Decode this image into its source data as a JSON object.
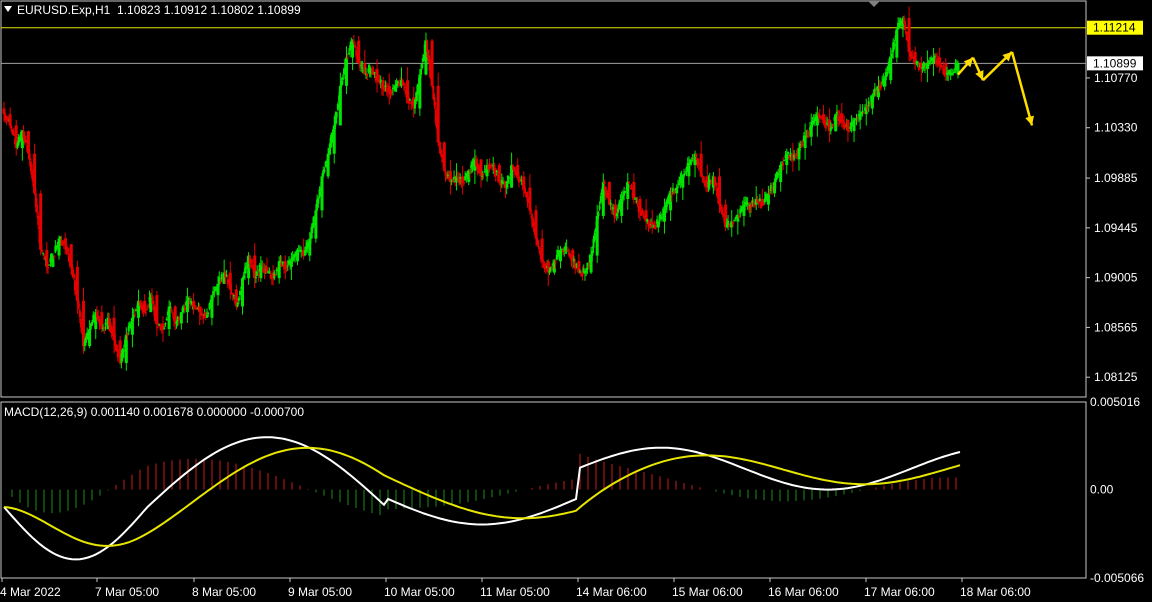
{
  "symbol_header": {
    "symbol": "EURUSD.Exp,H1",
    "open": "1.10823",
    "high": "1.10912",
    "low": "1.10802",
    "close": "1.10899"
  },
  "price_axis": {
    "ticks": [
      "1.10770",
      "1.10330",
      "1.09885",
      "1.09445",
      "1.09005",
      "1.08565",
      "1.08125"
    ],
    "resistance_label": "1.11214",
    "current_price_label": "1.10899"
  },
  "macd_panel": {
    "label": "MACD(12,26,9) 0.001140 0.001678 0.000000 -0.000700",
    "ticks": [
      "0.005016",
      "0.00",
      "-0.005066"
    ]
  },
  "time_axis": {
    "labels": [
      "4 Mar 2022",
      "7 Mar 05:00",
      "8 Mar 05:00",
      "9 Mar 05:00",
      "10 Mar 05:00",
      "11 Mar 05:00",
      "14 Mar 06:00",
      "15 Mar 06:00",
      "16 Mar 06:00",
      "17 Mar 06:00",
      "18 Mar 06:00"
    ]
  },
  "colors": {
    "bull_candle": "#00e600",
    "bear_candle": "#e60000",
    "resistance_line": "#e6e600",
    "price_line": "#a0a0a0",
    "macd_line": "#ffffff",
    "signal_line": "#e6e600",
    "arrow": "#ffdd00",
    "resistance_label_bg": "#ffff00",
    "axis_text": "#ffffff",
    "border": "#c8c8c8"
  },
  "icons": {
    "header_dropdown": "triangle-down-icon",
    "chart_shift_marker": "triangle-down-icon",
    "forecast_arrows": "arrow-icon"
  },
  "chart_data": {
    "type": "candlestick",
    "price_range": [
      1.0795,
      1.1145
    ],
    "resistance_level": 1.11214,
    "current_price": 1.10899,
    "candles_close_path": [
      1.1045,
      1.1035,
      1.1015,
      1.103,
      1.101,
      1.0975,
      1.0925,
      1.091,
      1.092,
      1.0935,
      1.093,
      1.091,
      1.088,
      1.084,
      1.0855,
      1.087,
      1.0855,
      1.0865,
      1.0845,
      1.0825,
      1.085,
      1.0865,
      1.088,
      1.087,
      1.0885,
      1.086,
      1.0855,
      1.0875,
      1.086,
      1.087,
      1.088,
      1.0875,
      1.087,
      1.0865,
      1.0885,
      1.0895,
      1.0905,
      1.089,
      1.0875,
      1.09,
      1.092,
      1.09,
      1.091,
      1.0905,
      1.09,
      1.0915,
      1.091,
      1.0915,
      1.0925,
      1.092,
      1.0935,
      1.096,
      1.099,
      1.101,
      1.1035,
      1.107,
      1.1095,
      1.111,
      1.109,
      1.108,
      1.1085,
      1.1075,
      1.107,
      1.1065,
      1.107,
      1.1075,
      1.106,
      1.105,
      1.108,
      1.111,
      1.107,
      1.102,
      1.0995,
      1.0985,
      1.099,
      1.0985,
      1.0995,
      1.1005,
      1.099,
      1.1,
      1.1,
      1.0985,
      1.098,
      1.1,
      1.099,
      1.098,
      1.096,
      1.0935,
      1.0915,
      1.0905,
      1.0915,
      1.0925,
      1.0925,
      1.0915,
      1.0905,
      1.0905,
      1.092,
      1.0955,
      1.0985,
      1.0965,
      1.0955,
      1.097,
      1.0985,
      1.097,
      1.096,
      1.095,
      1.0945,
      1.095,
      1.096,
      1.0975,
      1.098,
      1.099,
      1.1,
      1.101,
      1.099,
      1.098,
      1.099,
      1.0965,
      1.0945,
      1.095,
      1.0955,
      1.0965,
      1.0965,
      1.097,
      1.0965,
      1.0975,
      1.0985,
      1.1,
      1.101,
      1.1005,
      1.1015,
      1.1025,
      1.1035,
      1.1045,
      1.104,
      1.103,
      1.1045,
      1.104,
      1.103,
      1.104,
      1.1045,
      1.105,
      1.106,
      1.107,
      1.1075,
      1.1095,
      1.112,
      1.113,
      1.11,
      1.109,
      1.1085,
      1.109,
      1.1095,
      1.109,
      1.108,
      1.108,
      1.109
    ],
    "forecast_points": [
      [
        1.108,
        1.1095
      ],
      [
        1.1095,
        1.1075
      ],
      [
        1.1075,
        1.11
      ],
      [
        1.11,
        1.1035
      ]
    ],
    "macd": {
      "range": [
        -0.005066,
        0.005016
      ],
      "hist_sign_pattern": "negative early, positive around 7-9 Mar, negative after 10 Mar, mixed positive later"
    }
  }
}
